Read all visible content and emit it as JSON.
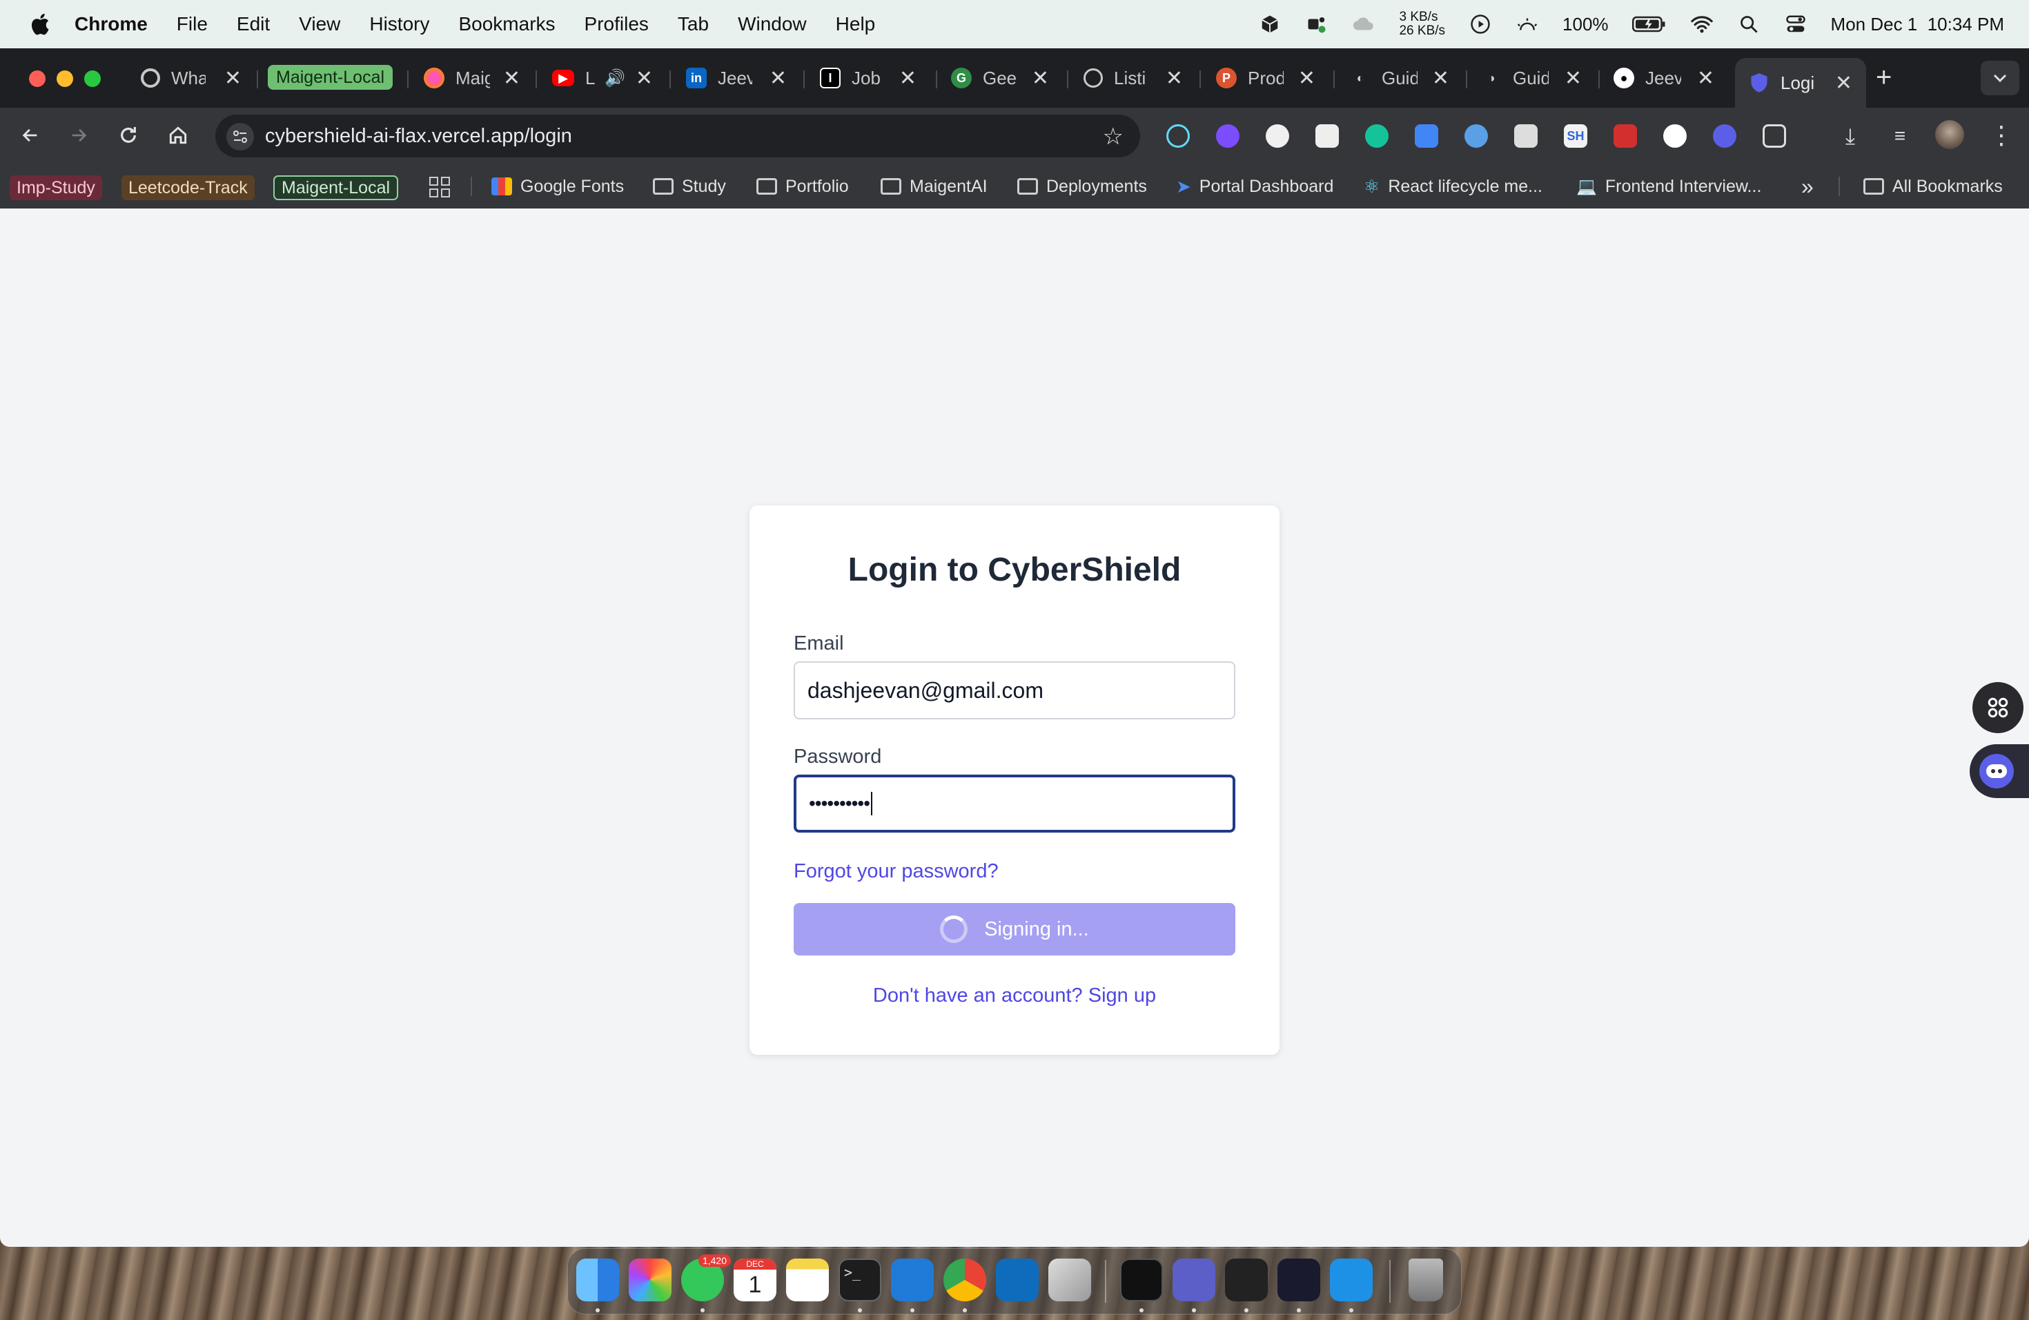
{
  "menubar": {
    "app": "Chrome",
    "items": [
      "File",
      "Edit",
      "View",
      "History",
      "Bookmarks",
      "Profiles",
      "Tab",
      "Window",
      "Help"
    ],
    "network_up": "3 KB/s",
    "network_down": "26 KB/s",
    "battery": "100%",
    "datetime": "Mon Dec 1  10:34 PM"
  },
  "tabs": [
    {
      "title": "Wha"
    },
    {
      "title": "Maigent-Local"
    },
    {
      "title": "Maig"
    },
    {
      "title": "L"
    },
    {
      "title": "Jeev"
    },
    {
      "title": "Job"
    },
    {
      "title": "Geel"
    },
    {
      "title": "Listi"
    },
    {
      "title": "Prod"
    },
    {
      "title": "Guid"
    },
    {
      "title": "Guid"
    },
    {
      "title": "Jeev"
    },
    {
      "title": "Logi"
    }
  ],
  "omnibox": {
    "url": "cybershield-ai-flax.vercel.app/login"
  },
  "bookmarks": {
    "chips": [
      "Imp-Study",
      "Leetcode-Track",
      "Maigent-Local"
    ],
    "items": [
      "Google Fonts",
      "Study",
      "Portfolio",
      "MaigentAI",
      "Deployments",
      "Portal Dashboard",
      "React lifecycle me...",
      "Frontend Interview..."
    ],
    "more": "»",
    "all": "All Bookmarks"
  },
  "login": {
    "title": "Login to CyberShield",
    "email_label": "Email",
    "email_value": "dashjeevan@gmail.com",
    "password_label": "Password",
    "password_value": "••••••••••",
    "forgot": "Forgot your password?",
    "submit": "Signing in...",
    "signup": "Don't have an account? Sign up"
  },
  "dock": {
    "messages_badge": "1,420",
    "calendar_month": "DEC",
    "calendar_day": "1"
  },
  "colors": {
    "accent": "#4f46e5",
    "button_loading": "#a5a0f2",
    "focus_border": "#1e3a8a",
    "page_bg": "#f3f4f6"
  }
}
